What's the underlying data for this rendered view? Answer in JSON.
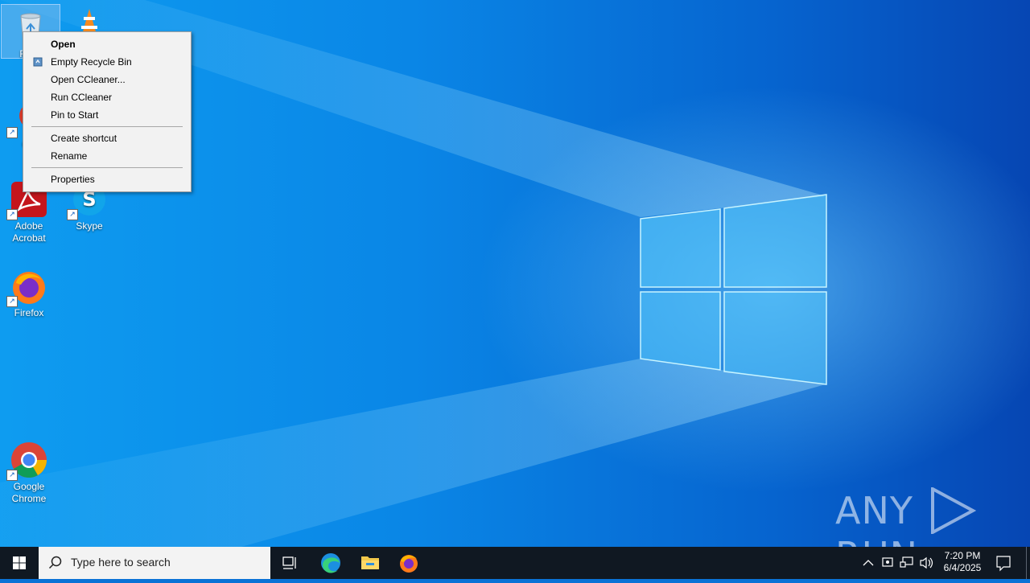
{
  "desktop": {
    "icons": [
      {
        "label": "Recy"
      },
      {
        "label": ""
      },
      {
        "label": "CC"
      },
      {
        "label": "Adobe\nAcrobat"
      },
      {
        "label": "Skype"
      },
      {
        "label": "Firefox"
      },
      {
        "label": "Google\nChrome"
      }
    ]
  },
  "context_menu": {
    "items": [
      "Open",
      "Empty Recycle Bin",
      "Open CCleaner...",
      "Run CCleaner",
      "Pin to Start",
      "Create shortcut",
      "Rename",
      "Properties"
    ]
  },
  "taskbar": {
    "search_placeholder": "Type here to search",
    "time": "7:20 PM",
    "date": "6/4/2025"
  },
  "watermark": "ANY RUN",
  "colors": {
    "menu_bg": "#f2f2f2",
    "taskbar_bg": "#101822",
    "desktop_blue": "#0a86e6"
  }
}
